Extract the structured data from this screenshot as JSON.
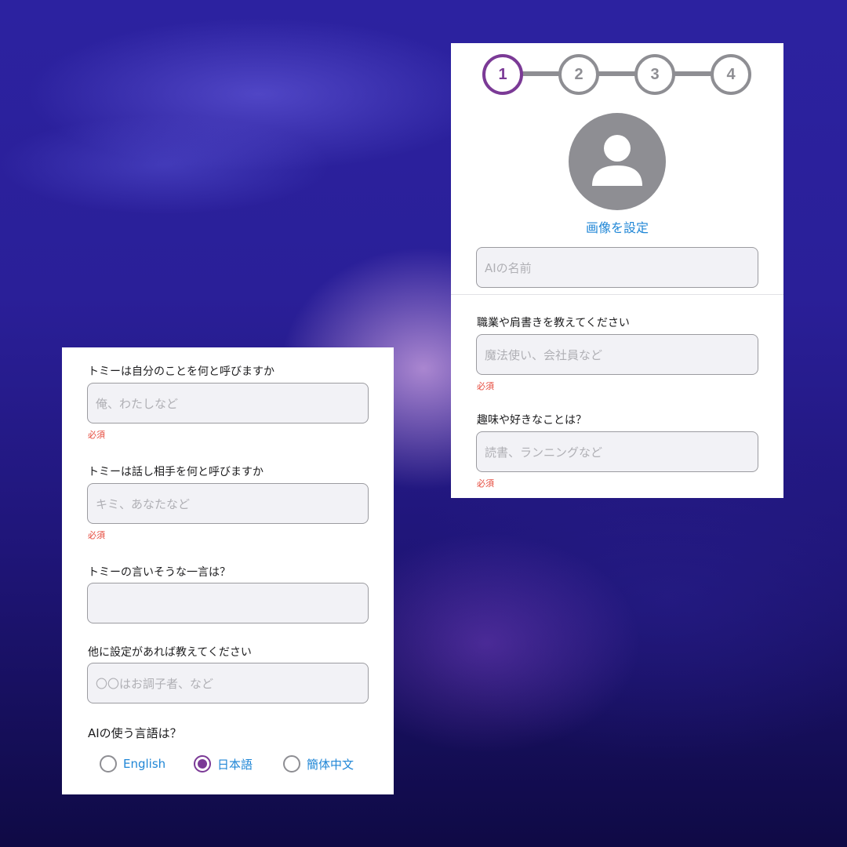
{
  "stepper": {
    "steps": [
      "1",
      "2",
      "3",
      "4"
    ],
    "active_index": 0,
    "active_color": "#7b3a96",
    "inactive_color": "#8e8e93"
  },
  "profile": {
    "avatar_icon": "person-silhouette-icon",
    "set_image_label": "画像を設定",
    "name_placeholder": "AIの名前"
  },
  "occupation": {
    "label": "職業や肩書きを教えてください",
    "placeholder": "魔法使い、会社員など",
    "required": "必須"
  },
  "hobby": {
    "label": "趣味や好きなことは？",
    "placeholder": "読書、ランニングなど",
    "required": "必須"
  },
  "self_name": {
    "label": "トミーは自分のことを何と呼びますか",
    "placeholder": "俺、わたしなど",
    "required": "必須"
  },
  "partner_name": {
    "label": "トミーは話し相手を何と呼びますか",
    "placeholder": "キミ、あなたなど",
    "required": "必須"
  },
  "catchphrase": {
    "label": "トミーの言いそうな一言は？",
    "placeholder": ""
  },
  "other_settings": {
    "label": "他に設定があれば教えてください",
    "placeholder": "〇〇はお調子者、など"
  },
  "language": {
    "label": "AIの使う言語は？",
    "options": [
      "English",
      "日本語",
      "簡体中文"
    ],
    "selected": "日本語",
    "accent_color": "#1f86d6"
  }
}
